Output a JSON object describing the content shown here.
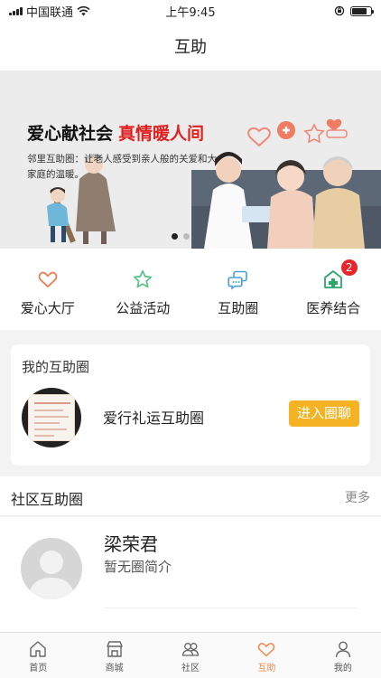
{
  "status_bar": {
    "carrier": "中国联通",
    "time": "上午9:45",
    "battery_level": 0.8
  },
  "nav": {
    "title": "互助"
  },
  "banner": {
    "headline_black": "爱心献社会",
    "headline_red": "真情暖人间",
    "subtitle": "邻里互助圈：让老人感受到亲人般的关爱和大家庭的温暖。",
    "slide_count": 2,
    "active_slide": 1
  },
  "quick_menu": [
    {
      "label": "爱心大厅",
      "icon": "heart-icon",
      "color": "#f07a4a"
    },
    {
      "label": "公益活动",
      "icon": "star-icon",
      "color": "#5fc48c"
    },
    {
      "label": "互助圈",
      "icon": "chat-bubbles-icon",
      "color": "#4a9fd8"
    },
    {
      "label": "医养结合",
      "icon": "medical-house-icon",
      "color": "#2aa86a",
      "badge": "2"
    }
  ],
  "my_circle": {
    "title": "我的互助圈",
    "circle_name": "爱行礼运互助圈",
    "join_label": "进入圈聊"
  },
  "community": {
    "title": "社区互助圈",
    "more_label": "更多",
    "items": [
      {
        "name": "梁荣君",
        "intro": "暂无圈简介"
      }
    ]
  },
  "tabs": [
    {
      "label": "首页",
      "icon": "home-icon",
      "active": false
    },
    {
      "label": "商城",
      "icon": "shop-icon",
      "active": false
    },
    {
      "label": "社区",
      "icon": "community-icon",
      "active": false
    },
    {
      "label": "互助",
      "icon": "heart-icon",
      "active": true
    },
    {
      "label": "我的",
      "icon": "person-icon",
      "active": false
    }
  ],
  "colors": {
    "accent": "#f0884a",
    "join_button": "#f5b324",
    "banner_red": "#e02020",
    "badge": "#e8262b"
  }
}
